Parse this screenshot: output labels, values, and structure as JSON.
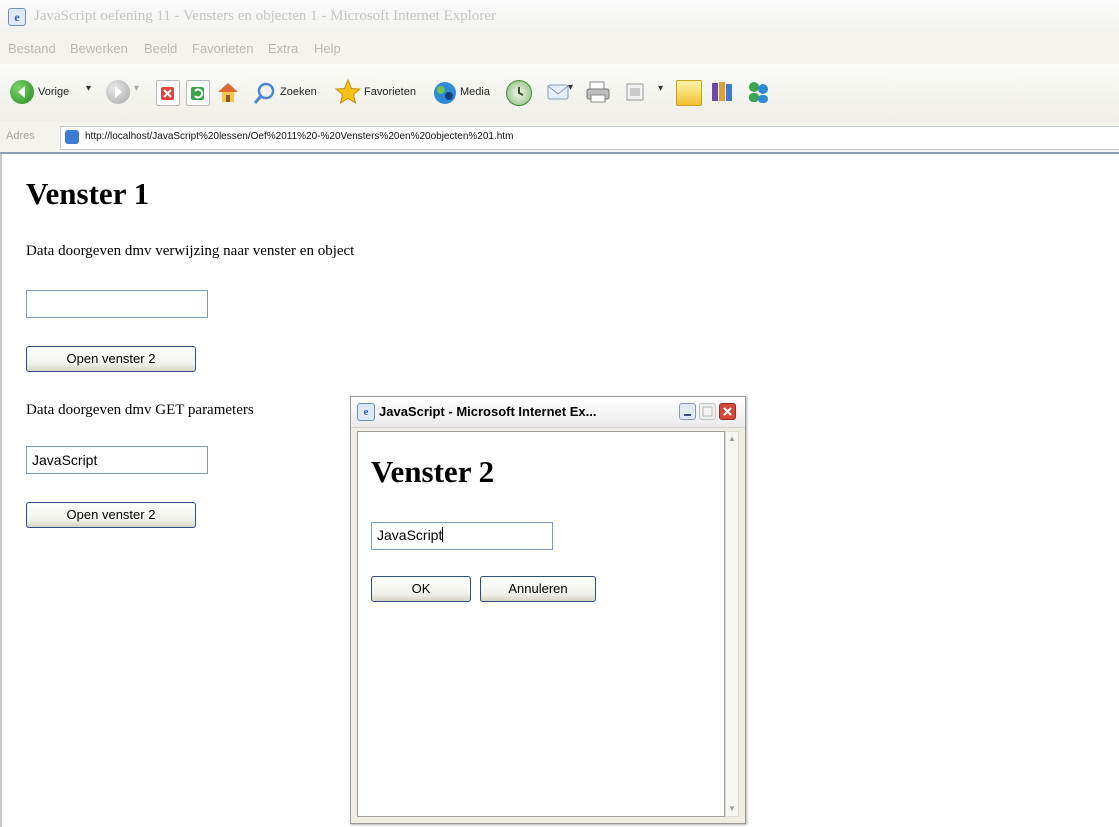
{
  "window": {
    "title": "JavaScript oefening 11 - Vensters en objecten 1 - Microsoft Internet Explorer",
    "icon": "ie-page-icon"
  },
  "menu": {
    "items": [
      "Bestand",
      "Bewerken",
      "Beeld",
      "Favorieten",
      "Extra",
      "Help"
    ]
  },
  "toolbar": {
    "back_label": "Vorige",
    "search_label": "Zoeken",
    "favorites_label": "Favorieten",
    "media_label": "Media"
  },
  "address": {
    "label": "Adres",
    "url": "http://localhost/JavaScript%20lessen/Oef%2011%20-%20Vensters%20en%20objecten%201.htm"
  },
  "page": {
    "heading": "Venster 1",
    "section1_text": "Data doorgeven dmv verwijzing naar venster en object",
    "input1_value": "",
    "button1_label": "Open venster 2",
    "section2_text": "Data doorgeven dmv GET parameters",
    "input2_value": "JavaScript",
    "button2_label": "Open venster 2"
  },
  "popup": {
    "title": "JavaScript - Microsoft Internet Ex...",
    "heading": "Venster 2",
    "input_value": "JavaScript",
    "ok_label": "OK",
    "cancel_label": "Annuleren"
  },
  "colors": {
    "link_blue": "#2a5db0",
    "button_border": "#2f4f80",
    "input_border": "#7f9db9",
    "close_red": "#d8463a"
  }
}
